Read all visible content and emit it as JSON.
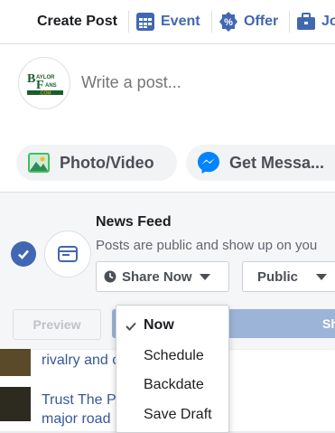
{
  "tabs": {
    "create_post": "Create Post",
    "event": "Event",
    "offer": "Offer",
    "jobs": "Jo"
  },
  "composer": {
    "placeholder": "Write a post...",
    "avatar_text": "BAYLOR FANS .COM"
  },
  "actions": {
    "photo_video": "Photo/Video",
    "get_messages": "Get Messa..."
  },
  "news_feed": {
    "title": "News Feed",
    "description": "Posts are public and show up on you",
    "share_now": "Share Now",
    "audience": "Public"
  },
  "footer": {
    "preview": "Preview",
    "share": "Sh"
  },
  "menu": {
    "items": [
      "Now",
      "Schedule",
      "Backdate",
      "Save Draft"
    ],
    "selected": "Now"
  },
  "background_feed": {
    "row1": "rivalry and c                         er",
    "row2_line1": "Trust The P                    rs fall, now a",
    "row2_line2": "major road"
  },
  "colors": {
    "accent": "#4267b2",
    "share_disabled": "#9cb4d8",
    "messenger": "#0084ff",
    "photo_green": "#45bd62"
  }
}
